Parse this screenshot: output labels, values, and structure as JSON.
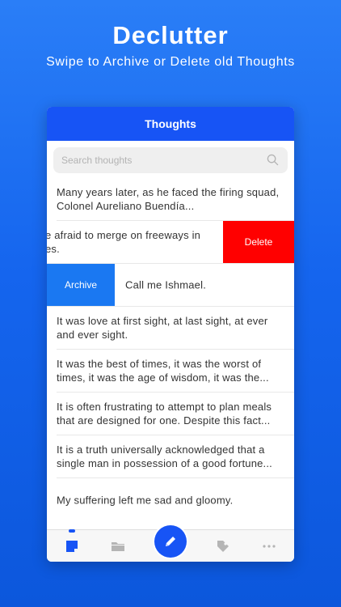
{
  "promo": {
    "title": "Declutter",
    "subtitle": "Swipe to Archive or Delete old Thoughts"
  },
  "app": {
    "nav_title": "Thoughts",
    "search_placeholder": "Search thoughts",
    "delete_label": "Delete",
    "archive_label": "Archive",
    "notes": [
      "Many years later, as he faced the firing squad, Colonel Aureliano Buendía...",
      "e afraid to merge on freeways in es.",
      "Call me Ishmael.",
      "It was love at first sight, at last sight, at ever and ever sight.",
      "It was the best of times, it was the worst of times, it was the age of wisdom, it was the...",
      "It is often frustrating to attempt to plan meals that are designed for one. Despite this fact...",
      "It is a truth universally acknowledged that a single man in possession of a good fortune...",
      "My suffering left me sad and gloomy."
    ],
    "swiped_note_lines": [
      "e afraid to merge on freeways in",
      "es."
    ],
    "tabs": [
      "notes-icon",
      "folder-icon",
      "compose-icon",
      "tag-icon",
      "more-icon"
    ],
    "colors": {
      "brand": "#1754f5",
      "delete": "#ff0000",
      "archive": "#1a78f2"
    }
  }
}
